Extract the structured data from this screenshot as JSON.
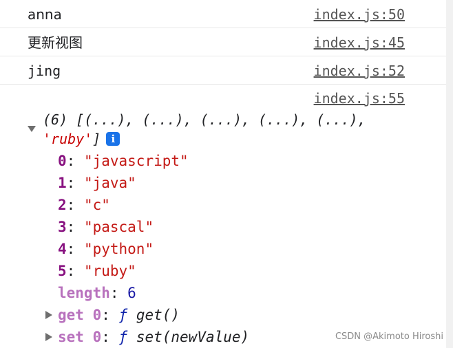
{
  "console": {
    "rows": [
      {
        "message": "anna",
        "source": "index.js:50"
      },
      {
        "message": "更新视图",
        "source": "index.js:45"
      },
      {
        "message": "jing",
        "source": "index.js:52"
      }
    ],
    "array_entry": {
      "source": "index.js:55",
      "summary_line1": "(6) [(...), (...), (...), (...), (...),",
      "summary_last_item": "'ruby'",
      "summary_close": "]",
      "info_icon": "i",
      "items": [
        {
          "index": "0",
          "value": "\"javascript\""
        },
        {
          "index": "1",
          "value": "\"java\""
        },
        {
          "index": "2",
          "value": "\"c\""
        },
        {
          "index": "3",
          "value": "\"pascal\""
        },
        {
          "index": "4",
          "value": "\"python\""
        },
        {
          "index": "5",
          "value": "\"ruby\""
        }
      ],
      "length_key": "length",
      "length_value": "6",
      "getter": {
        "key": "get 0",
        "f": "ƒ",
        "name": "get()"
      },
      "setter": {
        "key": "set 0",
        "f": "ƒ",
        "name": "set(newValue)"
      }
    }
  },
  "watermark": "CSDN @Akimoto Hiroshi",
  "colors": {
    "string": "#c41a16",
    "key": "#881280",
    "number": "#1a1aa6",
    "info_icon_bg": "#1a73e8"
  }
}
